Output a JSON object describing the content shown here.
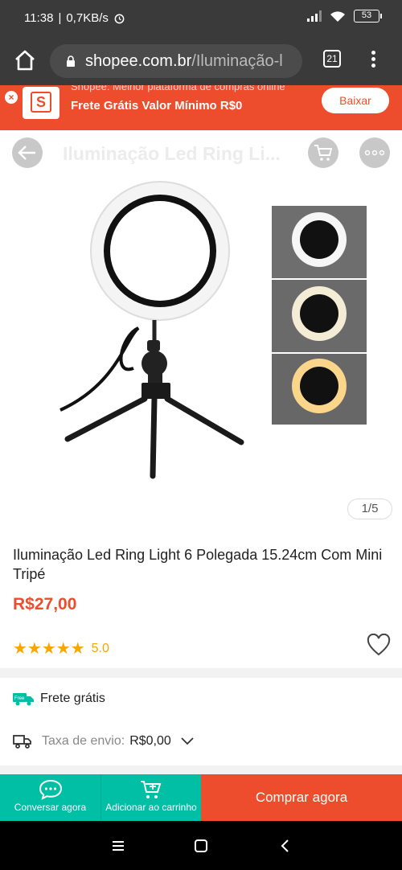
{
  "status_bar": {
    "time": "11:38",
    "network_speed": "0,7KB/s",
    "battery": "53",
    "icons": [
      "alarm-icon",
      "signal-icon",
      "wifi-icon",
      "battery-icon"
    ]
  },
  "browser": {
    "url_domain": "shopee.com.br",
    "url_path": "/Iluminação-l",
    "tab_count": "21"
  },
  "promo_banner": {
    "subline": "Shopee: Melhor plataforma de compras online",
    "mainline": "Frete Grátis Valor Mínimo R$0",
    "logo_letter": "S",
    "button_label": "Baixar"
  },
  "header": {
    "title": "Iluminação Led Ring Li..."
  },
  "gallery": {
    "counter": "1/5"
  },
  "product": {
    "title": "Iluminação Led Ring Light 6 Polegada 15.24cm Com Mini Tripé",
    "price": "R$27,00",
    "stars": "★★★★★",
    "rating": "5.0"
  },
  "shipping": {
    "free_label": "Frete grátis",
    "free_badge": "Free",
    "fee_label": "Taxa de envio:",
    "fee_value": "R$0,00"
  },
  "actions": {
    "chat_label": "Conversar agora",
    "cart_label": "Adicionar ao carrinho",
    "buy_label": "Comprar agora"
  },
  "colors": {
    "brand": "#ee4d2d",
    "teal": "#00bfa5",
    "star": "#f6a700"
  }
}
